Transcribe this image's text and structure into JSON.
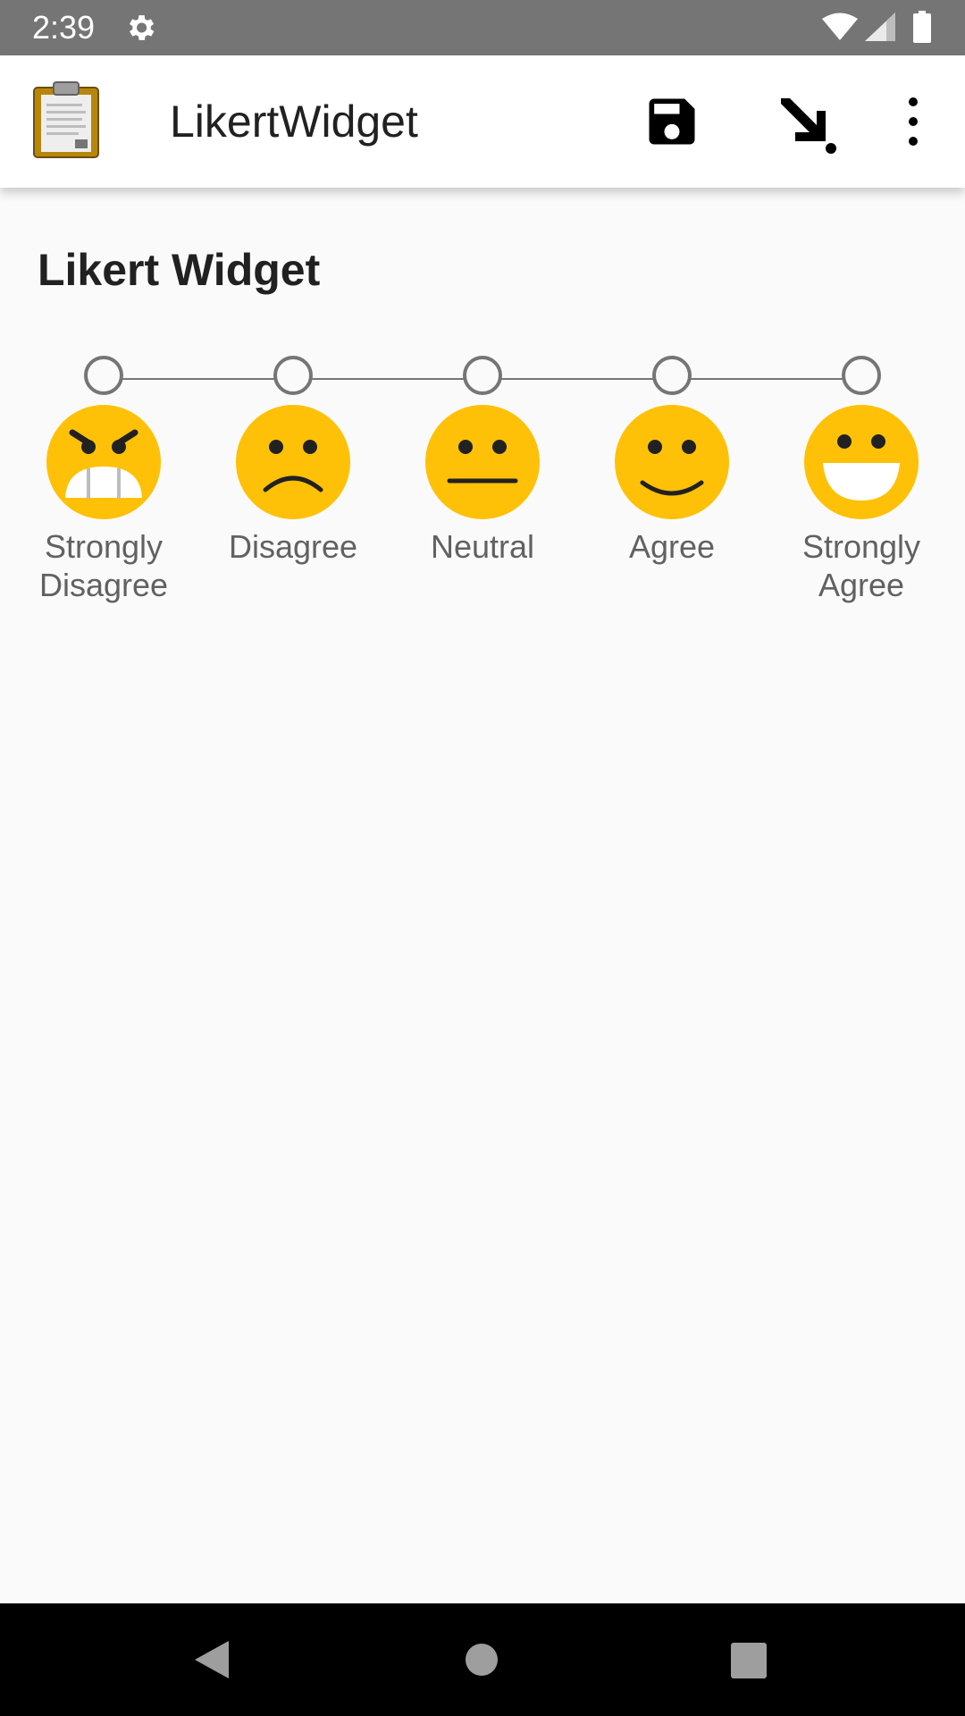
{
  "status_bar": {
    "time": "2:39",
    "icons": [
      "gear-icon",
      "wifi-icon",
      "signal-icon",
      "battery-icon"
    ]
  },
  "app_bar": {
    "title": "LikertWidget",
    "icons": [
      "clipboard-icon",
      "save-icon",
      "jump-to-icon",
      "more-vert-icon"
    ]
  },
  "question": {
    "label": "Likert Widget",
    "options": [
      {
        "label": "Strongly\nDisagree",
        "face": "angry-face-icon"
      },
      {
        "label": "Disagree",
        "face": "frowning-face-icon"
      },
      {
        "label": "Neutral",
        "face": "neutral-face-icon"
      },
      {
        "label": "Agree",
        "face": "smiling-face-icon"
      },
      {
        "label": "Strongly\nAgree",
        "face": "grinning-face-icon"
      }
    ]
  },
  "nav_bar": {
    "icons": [
      "back-icon",
      "home-icon",
      "recents-icon"
    ]
  },
  "colors": {
    "status_bar": "#757575",
    "face_yellow": "#FFC107",
    "radio_ring": "#757575",
    "background": "#fafafa"
  }
}
